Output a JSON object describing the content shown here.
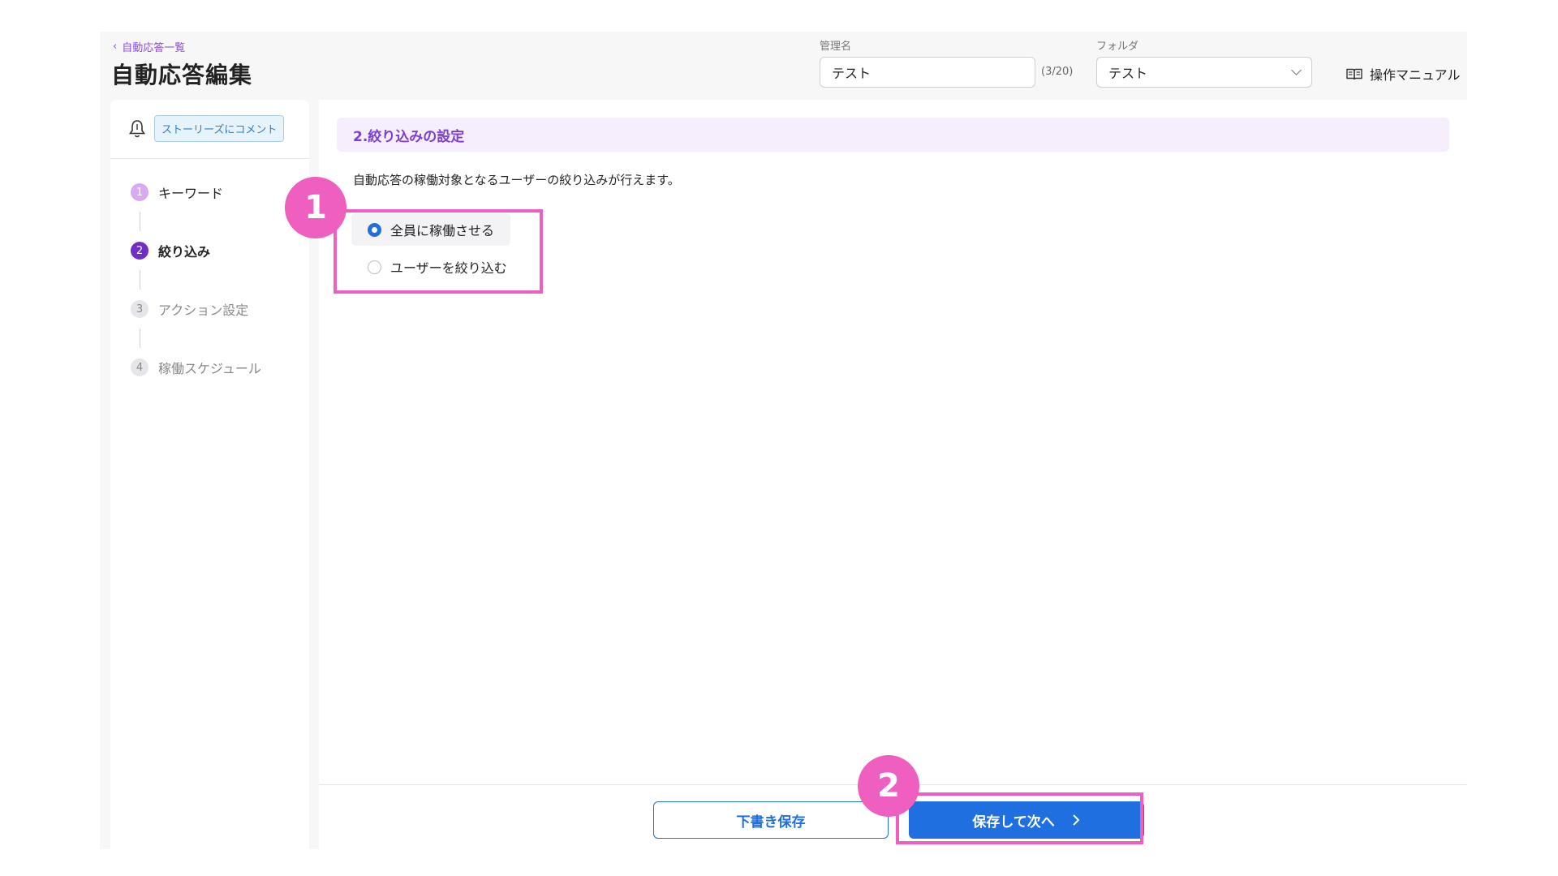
{
  "header": {
    "back_label": "自動応答一覧",
    "title": "自動応答編集",
    "name_label": "管理名",
    "name_value": "テスト",
    "name_counter": "(3/20)",
    "folder_label": "フォルダ",
    "folder_value": "テスト",
    "manual_label": "操作マニュアル"
  },
  "sidebar": {
    "trigger_badge": "ストーリーズにコメント",
    "steps": [
      {
        "num": "1",
        "label": "キーワード",
        "state": "done"
      },
      {
        "num": "2",
        "label": "絞り込み",
        "state": "active"
      },
      {
        "num": "3",
        "label": "アクション設定",
        "state": "pending"
      },
      {
        "num": "4",
        "label": "稼働スケジュール",
        "state": "pending"
      }
    ]
  },
  "main": {
    "section_title": "2.絞り込みの設定",
    "description": "自動応答の稼働対象となるユーザーの絞り込みが行えます。",
    "options": [
      {
        "label": "全員に稼働させる",
        "selected": true
      },
      {
        "label": "ユーザーを絞り込む",
        "selected": false
      }
    ]
  },
  "footer": {
    "draft_label": "下書き保存",
    "next_label": "保存して次へ",
    "next_icon": "chevron-right-icon"
  },
  "annotations": [
    "1",
    "2"
  ],
  "colors": {
    "accent": "#1f6fe0",
    "purple": "#7d3fcf",
    "annotation": "#ef5fbf"
  }
}
